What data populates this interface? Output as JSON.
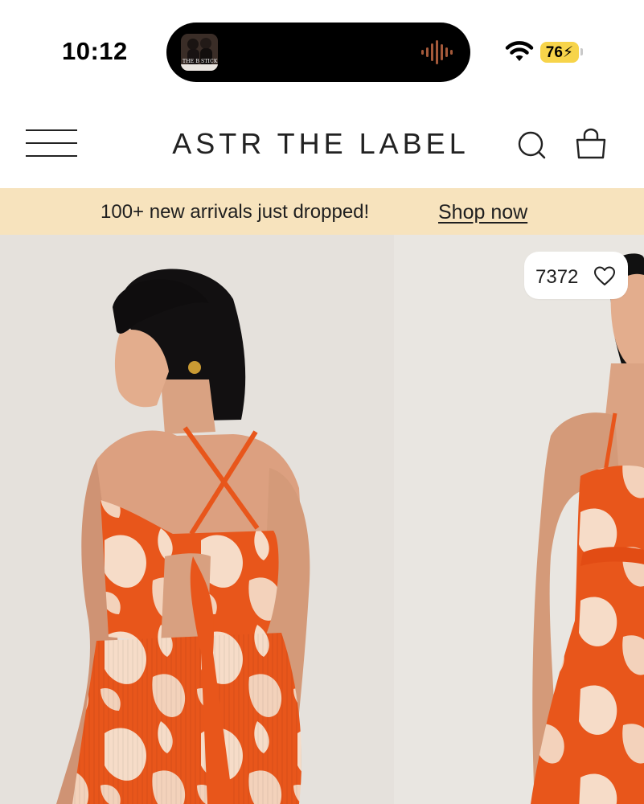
{
  "status_bar": {
    "time": "10:12",
    "battery": "76",
    "now_playing_art_text": "THE B STICK"
  },
  "header": {
    "brand": "ASTR THE LABEL",
    "menu_icon": "hamburger-menu-icon",
    "search_icon": "search-icon",
    "bag_icon": "shopping-bag-icon"
  },
  "promo": {
    "text": "100+ new arrivals just dropped!",
    "link": "Shop now",
    "background": "#f7e3bd"
  },
  "product": {
    "like_count": "7372",
    "like_icon": "heart-outline-icon",
    "dress_colors": [
      "#e8561b",
      "#f6dcc8"
    ]
  }
}
